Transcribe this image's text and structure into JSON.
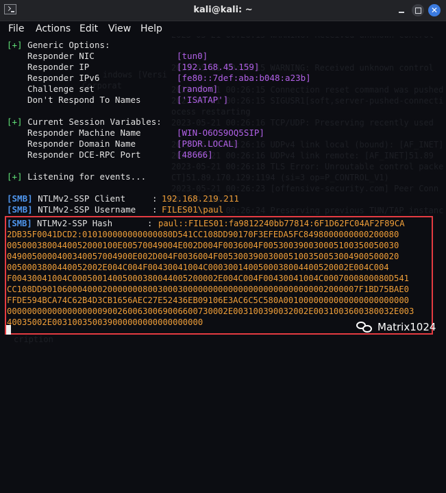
{
  "window": {
    "title": "kali@kali: ~",
    "menu": [
      "File",
      "Actions",
      "Edit",
      "View",
      "Help"
    ]
  },
  "background_ghost": [
    "File  Actions  Edit  View  Help",
    "2023-05-21 00:26:13 net_addr_v4_add: 192.168.45.159/24",
    "2023-05-21 00:26:13 Initialization Sequence Completed",
    "2023-05-21 00:26:15 WARNING: Received unknown control",
    "",
    "2023-05-21 00:26:15 WARNING: Received unknown control",
    "indows [Versi",
    "Corporat",
    "2023-05-21 00:26:15 Connection reset command was pushed",
    "2023-05-21 00:26:15 SIGUSR1[soft,server-pushed-connecti",
    "ocess restarting",
    "2023-05-21 00:26:16 TCP/UDP: Preserving recently used",
    "",
    "2023-05-21 00:26:16 UDPv4 link local (bound): [AF_INET]",
    "2023-05-21 00:26:16 UDPv4 link remote: [AF_INET]51.89",
    "2023-05-21 00:26:18 TLS Error: Unroutable control packe",
    "CT]51.89.170.129:1194 (si=3 op=P_CONTROL_V1)",
    "2023-05-21 00:26:23 [offensive-security.com] Peer Conn",
    "00.129:1194",
    "",
    "2023-05-21 00:26:24 Preserving previous TUN/TAP instanc",
    "",
    "cription"
  ],
  "terminal": {
    "generic_options_header": "Generic Options:",
    "generic_options": [
      {
        "label": "Responder NIC",
        "value": "[tun0]"
      },
      {
        "label": "Responder IP",
        "value": "[192.168.45.159]"
      },
      {
        "label": "Responder IPv6",
        "value": "[fe80::7def:aba:b048:a23b]"
      },
      {
        "label": "Challenge set",
        "value": "[random]"
      },
      {
        "label": "Don't Respond To Names",
        "value": "['ISATAP']"
      }
    ],
    "session_header": "Current Session Variables:",
    "session_vars": [
      {
        "label": "Responder Machine Name",
        "value": "[WIN-O6OS9OQ5SIP]"
      },
      {
        "label": "Responder Domain Name",
        "value": "[P8DR.LOCAL]"
      },
      {
        "label": "Responder DCE-RPC Port",
        "value": "[48666]"
      }
    ],
    "listening": "Listening for events...",
    "plus_marker": "[+]",
    "smb_tag": "[SMB]",
    "smb_lines": [
      {
        "label": "NTLMv2-SSP Client",
        "value": "192.168.219.211"
      },
      {
        "label": "NTLMv2-SSP Username",
        "value": "FILES01\\paul"
      }
    ],
    "hash_label": "NTLMv2-SSP Hash",
    "hash_lines": [
      "paul::FILES01:fa9812240bb77814:6F1D62FC04AF2F89CA",
      "2DB35F0041DCD2:010100000000000080D541CC108DD90170F3EFEDA5FC8498000000000200080",
      "0050003800440052000100E00570049004E002D004F0036004F005300390030005100350050030",
      "0490050000400340057004900E002D004F0036004F005300390030005100350053004900500020",
      "0050003800440052002E004C004F00430041004C0003001400500038004400520002E004C004",
      "F00430041004C00050014005000380044005200002E004C004F00430041004C0007000800080D541",
      "CC108DD901060004000200000008003000300000000000000000000000000002000007F1BD75BAE0",
      "FFDE594BCA74C62B4D3CB1656AEC27E52436EB09106E3AC6C5C580A0010000000000000000000000",
      "00000000000000000009002600630069006600730002E003100390032002E0031003600380032E003",
      "40035002E003100350039000000000000000000"
    ]
  },
  "watermark": "Matrix1024"
}
